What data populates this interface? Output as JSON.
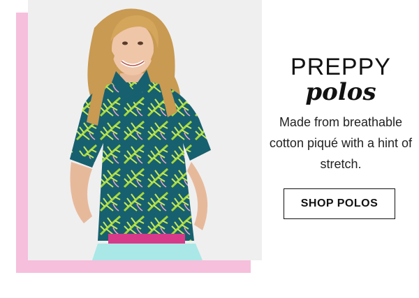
{
  "promo": {
    "headline": "PREPPY",
    "subhead": "polos",
    "body": "Made from breathable cotton piqué with a hint of stretch.",
    "cta_label": "SHOP POLOS"
  },
  "colors": {
    "accent_pink": "#f6bfdc",
    "text_dark": "#111111",
    "polo_teal": "#1a6b7a",
    "palm_green": "#9ad33a"
  }
}
